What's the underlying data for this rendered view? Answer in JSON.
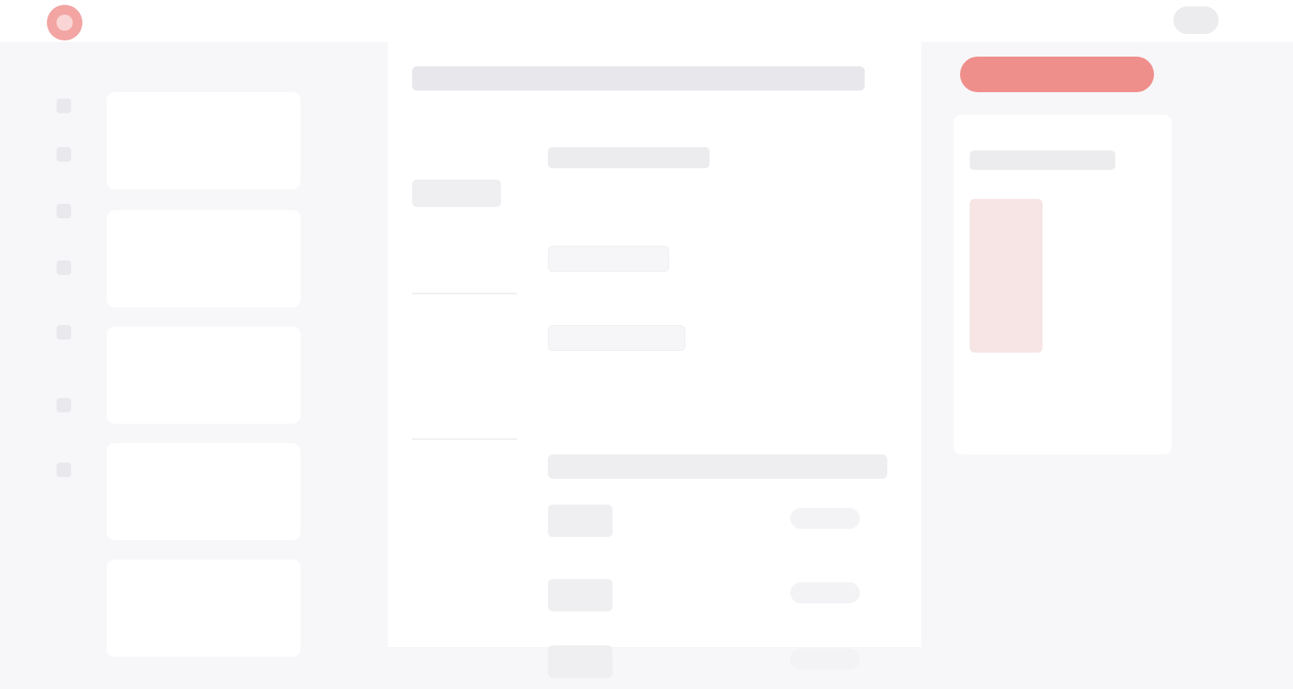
{
  "app": {
    "brand": "",
    "top_link": "",
    "avatar_label": ""
  },
  "rail": {
    "icons": [
      "home-icon",
      "inbox-icon",
      "calendar-icon",
      "chart-icon",
      "users-icon",
      "settings-icon",
      "help-icon"
    ]
  },
  "list": {
    "cards": [
      {
        "title": "",
        "line1": "",
        "line2": ""
      },
      {
        "title": "",
        "line1": "",
        "line2": ""
      },
      {
        "title": "",
        "line1": "",
        "line2": ""
      },
      {
        "title": "",
        "line1": "",
        "line2": ""
      },
      {
        "title": "",
        "line1": "",
        "line2": ""
      }
    ]
  },
  "content": {
    "title": "",
    "subnav": {
      "items": [
        {
          "label": "",
          "active": true
        },
        {
          "label": ""
        },
        {
          "label": ""
        },
        {
          "label": ""
        },
        {
          "label": ""
        }
      ]
    },
    "form": {
      "heading": "",
      "subheading": "",
      "fields": [
        {
          "label": "",
          "value": ""
        },
        {
          "label": "",
          "value": ""
        }
      ],
      "section_bar": "",
      "rows": [
        {
          "text": "",
          "tag": ""
        },
        {
          "text": "",
          "tag": ""
        },
        {
          "text": "",
          "tag": ""
        }
      ]
    }
  },
  "right": {
    "primary_button": "",
    "card": {
      "title": "",
      "name": "",
      "line1": "",
      "line2": "",
      "caption": ""
    }
  },
  "colors": {
    "accent": "#ef8f8c",
    "accent_soft": "#f6e5e4",
    "background": "#f7f7f9"
  }
}
